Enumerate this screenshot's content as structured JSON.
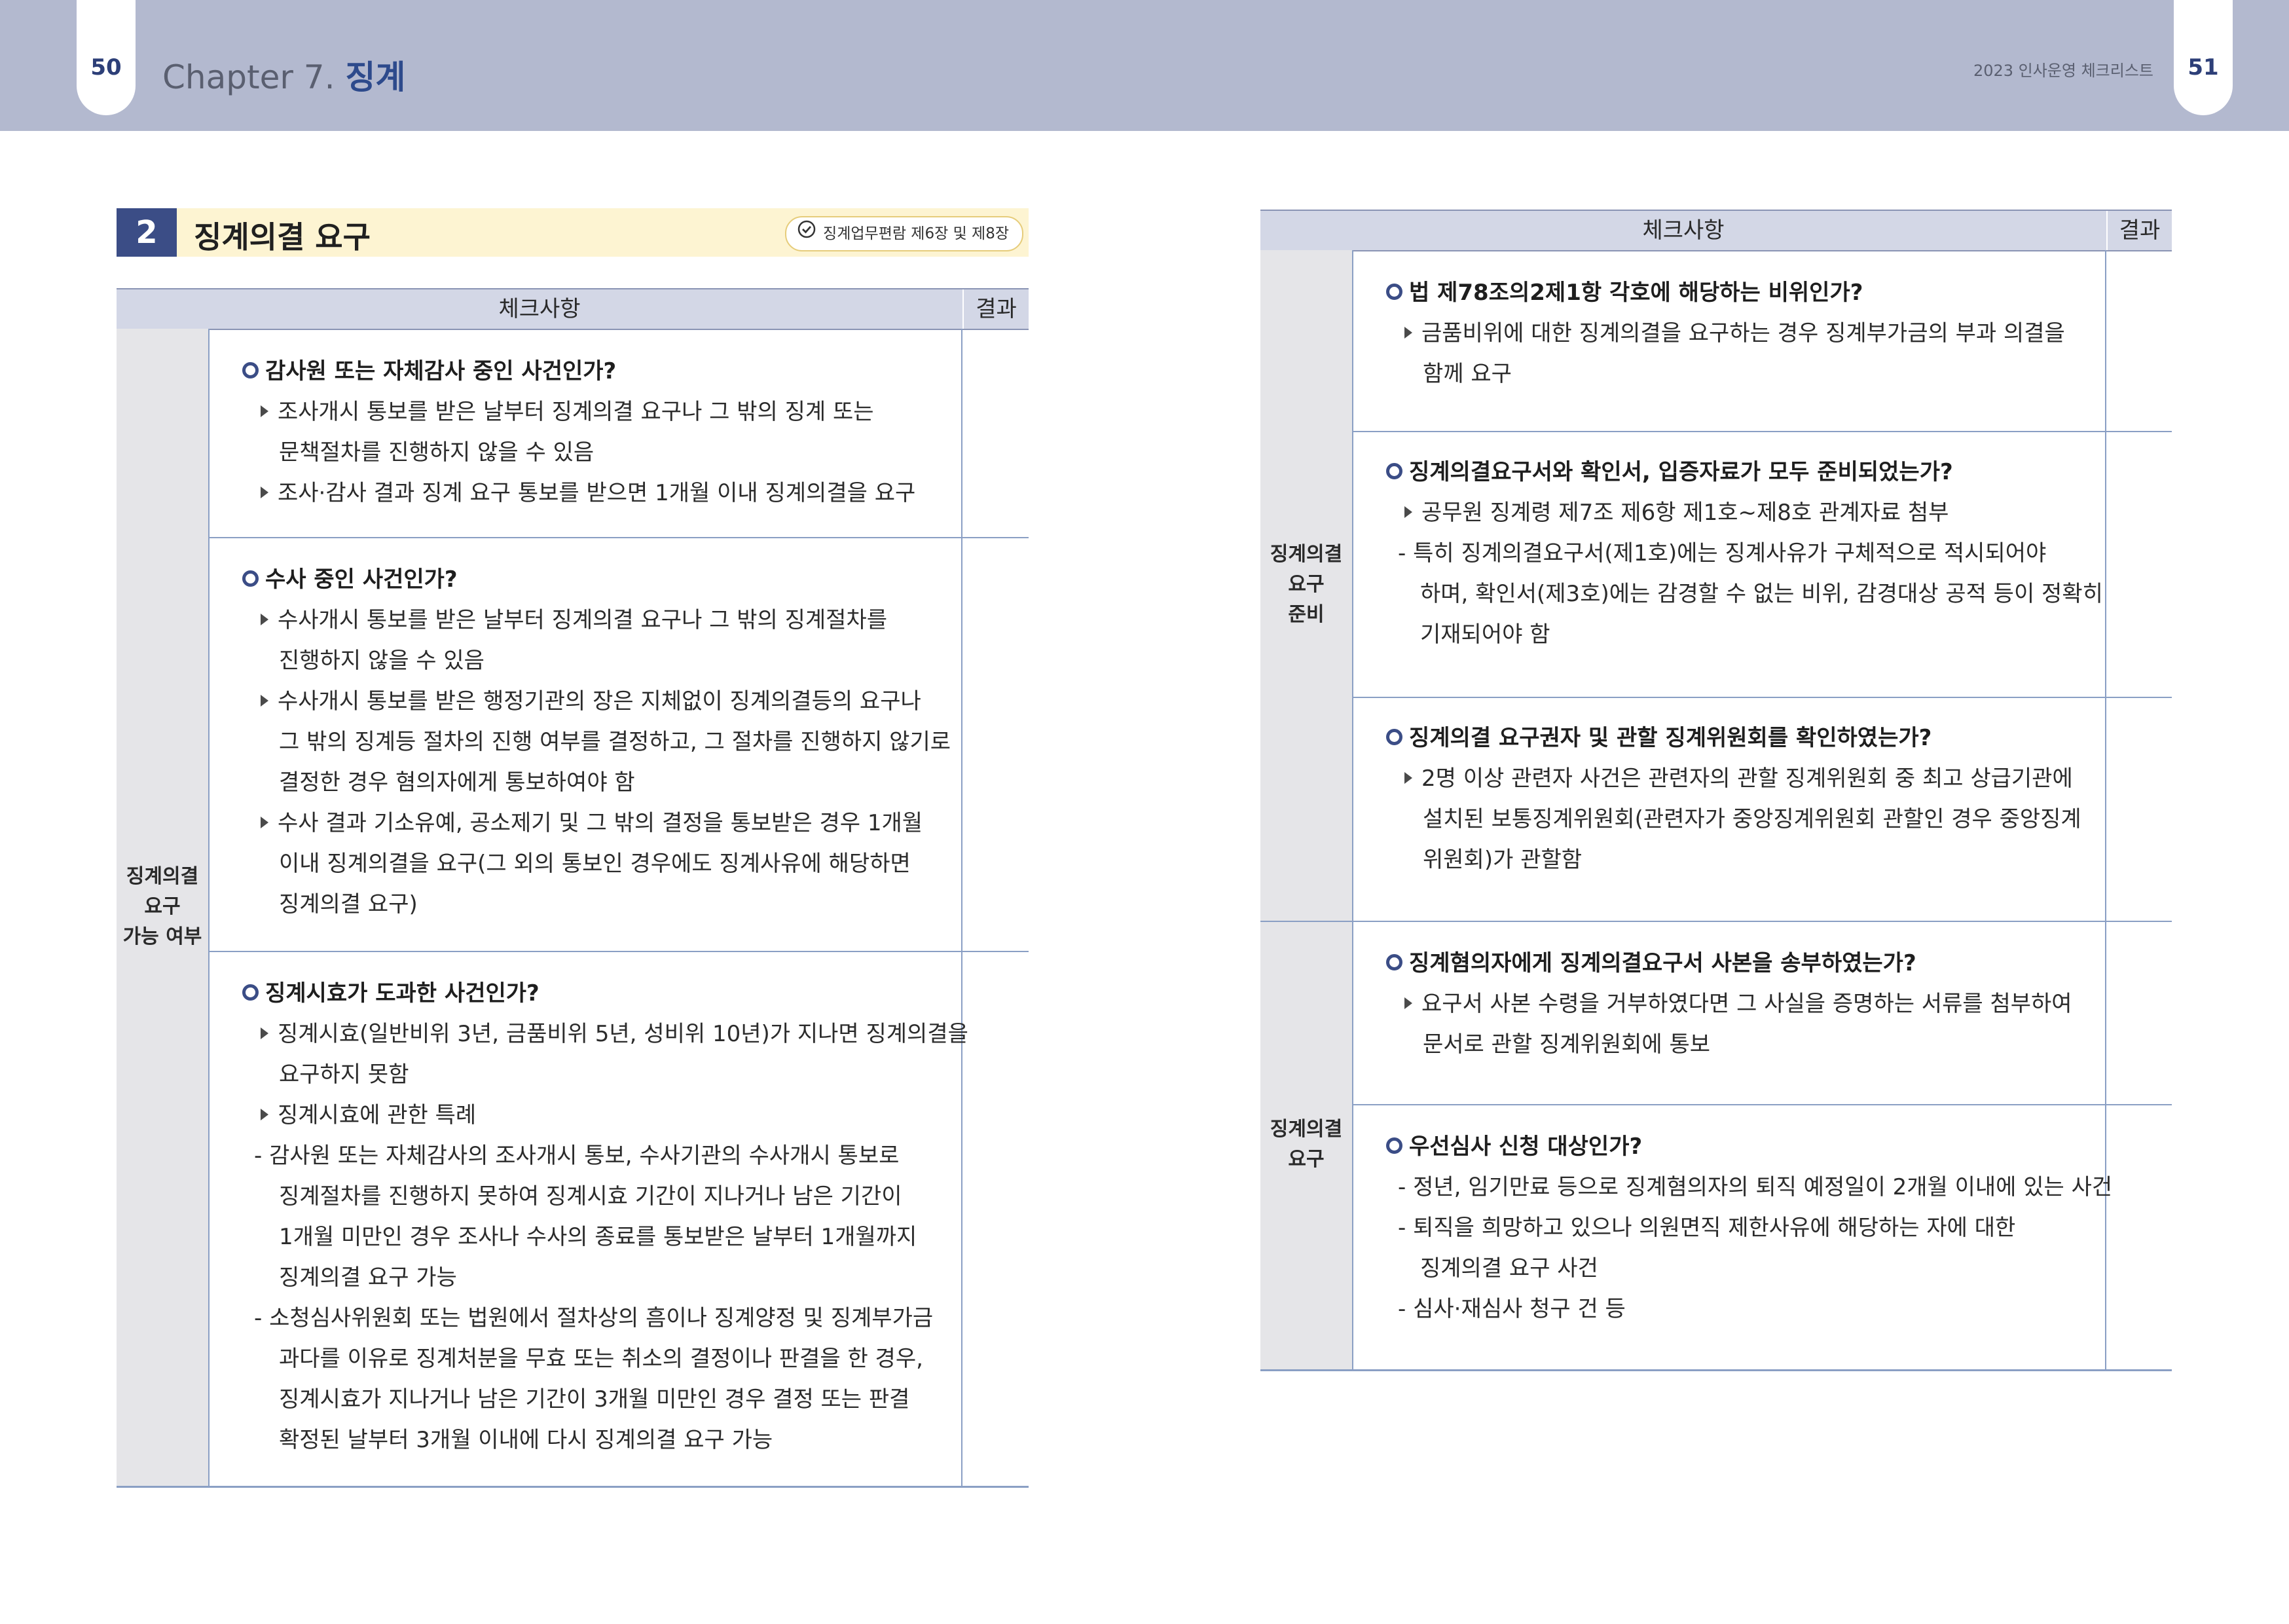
{
  "header": {
    "left_page_number": "50",
    "right_page_number": "51",
    "chapter_prefix": "Chapter 7.",
    "chapter_name": "징계",
    "book_title": "2023 인사운영 체크리스트"
  },
  "section": {
    "number": "2",
    "title": "징계의결 요구",
    "reference": "징계업무편람 제6장 및 제8장"
  },
  "left_table": {
    "col_check": "체크사항",
    "col_result": "결과",
    "category": [
      "징계의결",
      "요구",
      "가능 여부"
    ],
    "blocks": [
      {
        "question": "감사원 또는 자체감사 중인 사건인가?",
        "items": [
          {
            "mark": "tri",
            "text": "조사개시 통보를 받은 날부터 징계의결 요구나 그 밖의 징계 또는"
          },
          {
            "mark": "",
            "text": "문책절차를 진행하지 않을 수 있음"
          },
          {
            "mark": "tri",
            "text": "조사·감사 결과 징계 요구 통보를 받으면 1개월 이내 징계의결을 요구"
          }
        ]
      },
      {
        "question": "수사 중인 사건인가?",
        "items": [
          {
            "mark": "tri",
            "text": "수사개시 통보를 받은 날부터 징계의결 요구나 그 밖의 징계절차를"
          },
          {
            "mark": "",
            "text": "진행하지 않을 수 있음"
          },
          {
            "mark": "tri",
            "text": "수사개시 통보를 받은 행정기관의 장은 지체없이 징계의결등의 요구나"
          },
          {
            "mark": "",
            "text": "그 밖의 징계등 절차의 진행 여부를 결정하고, 그 절차를 진행하지 않기로"
          },
          {
            "mark": "",
            "text": "결정한 경우 혐의자에게 통보하여야 함"
          },
          {
            "mark": "tri",
            "text": "수사 결과 기소유예, 공소제기 및 그 밖의 결정을 통보받은 경우 1개월"
          },
          {
            "mark": "",
            "text": "이내 징계의결을 요구(그 외의 통보인 경우에도 징계사유에 해당하면"
          },
          {
            "mark": "",
            "text": "징계의결 요구)"
          }
        ]
      },
      {
        "question": "징계시효가 도과한 사건인가?",
        "items": [
          {
            "mark": "tri",
            "text": "징계시효(일반비위 3년, 금품비위 5년, 성비위 10년)가 지나면 징계의결을"
          },
          {
            "mark": "",
            "text": "요구하지 못함"
          },
          {
            "mark": "tri",
            "text": "징계시효에 관한 특례"
          },
          {
            "mark": "dash",
            "text": "- 감사원 또는 자체감사의 조사개시 통보, 수사기관의 수사개시 통보로"
          },
          {
            "mark": "",
            "text": "징계절차를 진행하지 못하여 징계시효 기간이 지나거나 남은 기간이"
          },
          {
            "mark": "",
            "text": "1개월 미만인 경우 조사나 수사의 종료를 통보받은 날부터 1개월까지"
          },
          {
            "mark": "",
            "text": "징계의결 요구 가능"
          },
          {
            "mark": "dash",
            "text": "- 소청심사위원회 또는 법원에서 절차상의 흠이나 징계양정 및 징계부가금"
          },
          {
            "mark": "",
            "text": "과다를 이유로 징계처분을 무효 또는 취소의 결정이나 판결을 한 경우,"
          },
          {
            "mark": "",
            "text": "징계시효가 지나거나 남은 기간이 3개월 미만인 경우 결정 또는 판결"
          },
          {
            "mark": "",
            "text": "확정된 날부터 3개월 이내에 다시 징계의결 요구 가능"
          }
        ]
      }
    ]
  },
  "right_table": {
    "col_check": "체크사항",
    "col_result": "결과",
    "categories": [
      {
        "label": [
          "징계의결",
          "요구",
          "준비"
        ]
      },
      {
        "label": [
          "징계의결",
          "요구"
        ]
      }
    ],
    "blocks": [
      {
        "question": "법 제78조의2제1항 각호에 해당하는 비위인가?",
        "items": [
          {
            "mark": "tri",
            "text": "금품비위에 대한 징계의결을 요구하는 경우 징계부가금의 부과 의결을"
          },
          {
            "mark": "",
            "text": "함께 요구"
          }
        ]
      },
      {
        "question": "징계의결요구서와 확인서, 입증자료가 모두 준비되었는가?",
        "items": [
          {
            "mark": "tri",
            "text": "공무원 징계령 제7조 제6항 제1호~제8호 관계자료 첨부"
          },
          {
            "mark": "dash",
            "text": "- 특히 징계의결요구서(제1호)에는 징계사유가 구체적으로 적시되어야"
          },
          {
            "mark": "",
            "text": "하며, 확인서(제3호)에는 감경할 수 없는 비위, 감경대상 공적 등이 정확히"
          },
          {
            "mark": "",
            "text": "기재되어야 함"
          }
        ]
      },
      {
        "question": "징계의결 요구권자 및 관할 징계위원회를 확인하였는가?",
        "items": [
          {
            "mark": "tri",
            "text": "2명 이상 관련자 사건은 관련자의 관할 징계위원회 중 최고 상급기관에"
          },
          {
            "mark": "",
            "text": "설치된 보통징계위원회(관련자가 중앙징계위원회 관할인 경우 중앙징계"
          },
          {
            "mark": "",
            "text": "위원회)가 관할함"
          }
        ]
      },
      {
        "question": "징계혐의자에게 징계의결요구서 사본을 송부하였는가?",
        "items": [
          {
            "mark": "tri",
            "text": "요구서 사본 수령을 거부하였다면 그 사실을 증명하는 서류를 첨부하여"
          },
          {
            "mark": "",
            "text": "문서로 관할 징계위원회에 통보"
          }
        ]
      },
      {
        "question": "우선심사 신청 대상인가?",
        "items": [
          {
            "mark": "dash",
            "text": "- 정년, 임기만료 등으로 징계혐의자의 퇴직 예정일이 2개월 이내에 있는 사건"
          },
          {
            "mark": "dash",
            "text": "- 퇴직을 희망하고 있으나 의원면직 제한사유에 해당하는 자에 대한"
          },
          {
            "mark": "",
            "text": "징계의결 요구 사건"
          },
          {
            "mark": "dash",
            "text": "- 심사·재심사 청구 건 등"
          }
        ]
      }
    ]
  }
}
